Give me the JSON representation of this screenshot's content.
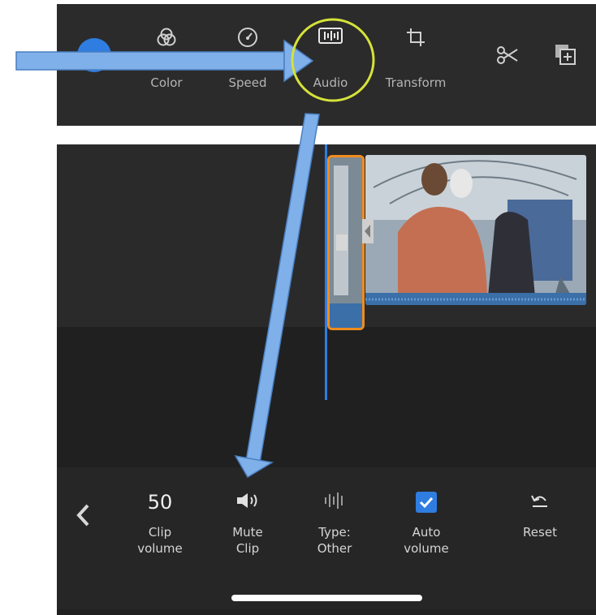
{
  "toolbar": {
    "tools": [
      {
        "name": "add",
        "label": "",
        "icon": "plus-circle-icon"
      },
      {
        "name": "color",
        "label": "Color",
        "icon": "color-wheel-icon"
      },
      {
        "name": "speed",
        "label": "Speed",
        "icon": "speedometer-icon"
      },
      {
        "name": "audio",
        "label": "Audio",
        "icon": "audio-waveform-icon"
      },
      {
        "name": "transform",
        "label": "Transform",
        "icon": "crop-icon"
      },
      {
        "name": "split",
        "label": "",
        "icon": "scissors-icon"
      },
      {
        "name": "duplicate",
        "label": "",
        "icon": "duplicate-icon"
      }
    ]
  },
  "bottom_bar": {
    "back_icon": "chevron-left-icon",
    "clip_volume": {
      "value": "50",
      "label_line1": "Clip",
      "label_line2": "volume"
    },
    "mute_clip": {
      "label_line1": "Mute",
      "label_line2": "Clip",
      "icon": "speaker-icon"
    },
    "type": {
      "label_line1": "Type:",
      "label_line2": "Other",
      "icon": "waveform-bars-icon"
    },
    "auto_volume": {
      "label_line1": "Auto",
      "label_line2": "volume",
      "checked": true,
      "icon": "checkbox-checked-icon"
    },
    "reset": {
      "label": "Reset",
      "icon": "undo-icon"
    }
  },
  "colors": {
    "accent_blue": "#2f7de1",
    "annotation_arrow": "#7fb0ea",
    "highlight_circle": "#d6e23a",
    "clip_selection": "#f08c1e"
  }
}
